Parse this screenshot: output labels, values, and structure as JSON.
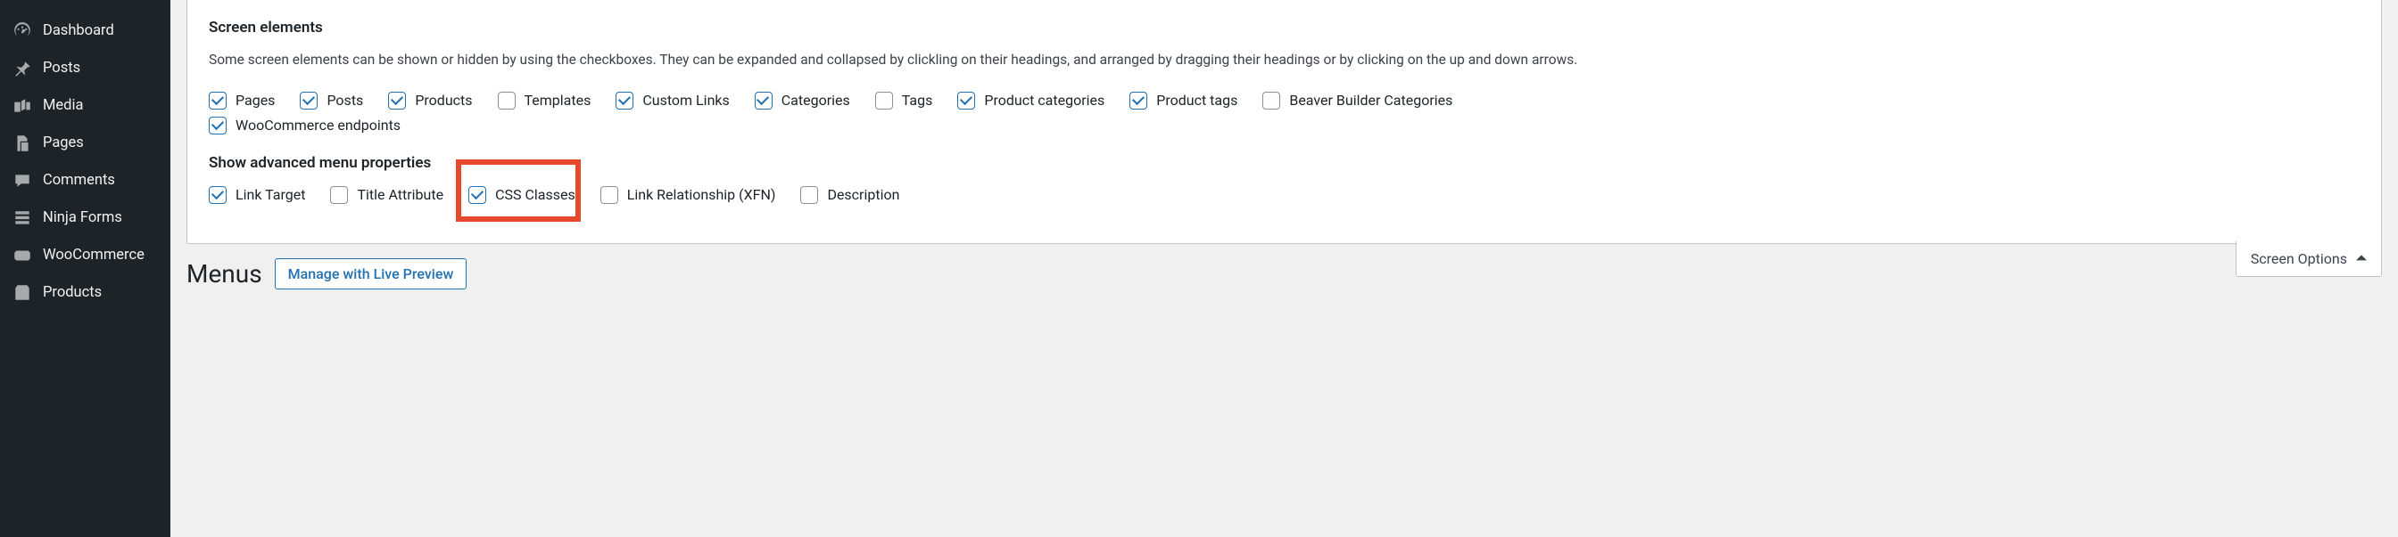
{
  "sidebar": {
    "items": [
      {
        "label": "Dashboard",
        "icon": "dashboard"
      },
      {
        "label": "Posts",
        "icon": "pin"
      },
      {
        "label": "Media",
        "icon": "media"
      },
      {
        "label": "Pages",
        "icon": "pages"
      },
      {
        "label": "Comments",
        "icon": "comment"
      },
      {
        "label": "Ninja Forms",
        "icon": "form"
      },
      {
        "label": "WooCommerce",
        "icon": "woo"
      },
      {
        "label": "Products",
        "icon": "product"
      }
    ]
  },
  "panel": {
    "heading_elements": "Screen elements",
    "description": "Some screen elements can be shown or hidden by using the checkboxes. They can be expanded and collapsed by clickling on their headings, and arranged by dragging their headings or by clicking on the up and down arrows.",
    "checkboxes_elements": [
      {
        "label": "Pages",
        "checked": true
      },
      {
        "label": "Posts",
        "checked": true
      },
      {
        "label": "Products",
        "checked": true
      },
      {
        "label": "Templates",
        "checked": false
      },
      {
        "label": "Custom Links",
        "checked": true
      },
      {
        "label": "Categories",
        "checked": true
      },
      {
        "label": "Tags",
        "checked": false
      },
      {
        "label": "Product categories",
        "checked": true
      },
      {
        "label": "Product tags",
        "checked": true
      },
      {
        "label": "Beaver Builder Categories",
        "checked": false
      },
      {
        "label": "WooCommerce endpoints",
        "checked": true
      }
    ],
    "heading_advanced": "Show advanced menu properties",
    "checkboxes_advanced": [
      {
        "label": "Link Target",
        "checked": true
      },
      {
        "label": "Title Attribute",
        "checked": false
      },
      {
        "label": "CSS Classes",
        "checked": true
      },
      {
        "label": "Link Relationship (XFN)",
        "checked": false
      },
      {
        "label": "Description",
        "checked": false
      }
    ]
  },
  "titlebar": {
    "heading": "Menus",
    "button": "Manage with Live Preview"
  },
  "screen_options_tab": "Screen Options",
  "colors": {
    "accent": "#2271b1",
    "highlight": "#e8492c"
  }
}
